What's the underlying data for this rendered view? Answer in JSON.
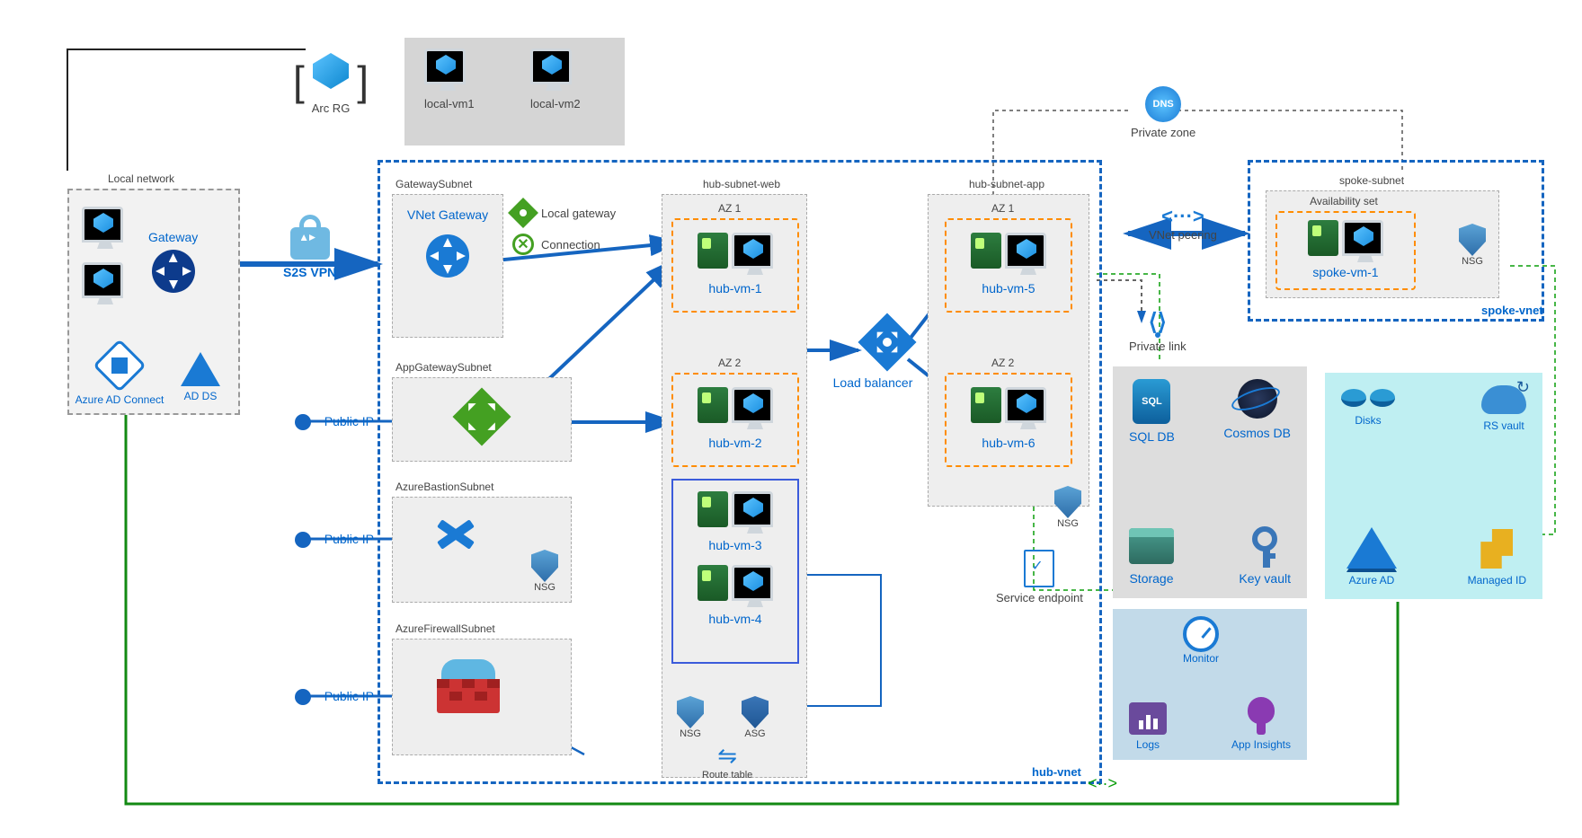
{
  "local_network": {
    "title": "Local network",
    "gateway": "Gateway",
    "ad_connect": "Azure AD Connect",
    "ad_ds": "AD DS"
  },
  "arc": {
    "label": "Arc RG",
    "vm1": "local-vm1",
    "vm2": "local-vm2"
  },
  "s2s_vpn": "S2S VPN",
  "hub": {
    "vnet": "hub-vnet",
    "gateway_subnet": "GatewaySubnet",
    "vnet_gateway": "VNet Gateway",
    "local_gateway": "Local gateway",
    "connection": "Connection",
    "app_gw_subnet": "AppGatewaySubnet",
    "bastion_subnet": "AzureBastionSubnet",
    "firewall_subnet": "AzureFirewallSubnet",
    "web_subnet": "hub-subnet-web",
    "app_subnet": "hub-subnet-app",
    "az1": "AZ 1",
    "az2": "AZ 2",
    "vm1": "hub-vm-1",
    "vm2": "hub-vm-2",
    "vm3": "hub-vm-3",
    "vm4": "hub-vm-4",
    "vm5": "hub-vm-5",
    "vm6": "hub-vm-6",
    "lb": "Load  balancer",
    "nsg": "NSG",
    "asg": "ASG",
    "route_table": "Route table"
  },
  "pub_ip": "Public IP",
  "private_zone": "Private zone",
  "vnet_peering": "VNet peering",
  "private_link": "Private link",
  "service_endpoint": "Service endpoint",
  "spoke": {
    "vnet": "spoke-vnet",
    "subnet": "spoke-subnet",
    "avset": "Availability set",
    "vm1": "spoke-vm-1",
    "nsg": "NSG"
  },
  "services": {
    "sql": "SQL DB",
    "cosmos": "Cosmos DB",
    "storage": "Storage",
    "kv": "Key vault"
  },
  "monitor": {
    "title": "Monitor",
    "logs": "Logs",
    "insights": "App Insights"
  },
  "backup": {
    "disks": "Disks",
    "rsv": "RS vault",
    "aad": "Azure AD",
    "mid": "Managed ID"
  }
}
